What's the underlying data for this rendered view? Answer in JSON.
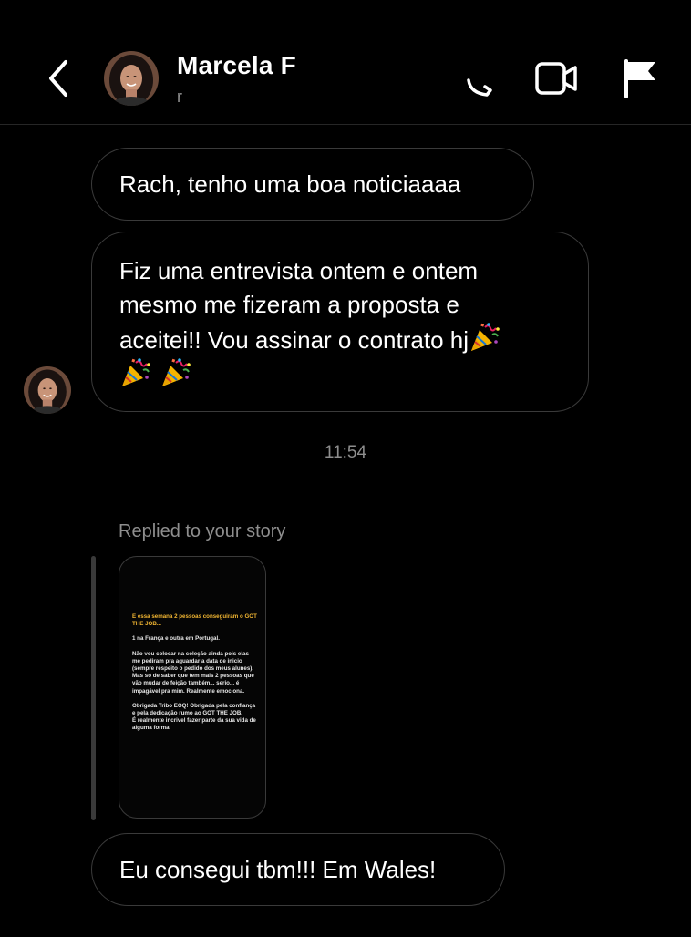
{
  "header": {
    "contact_name": "Marcela F",
    "contact_sub": "r"
  },
  "messages": [
    {
      "text": "Rach, tenho uma boa noticiaaaa"
    },
    {
      "lines": [
        "Fiz uma entrevista ontem e ontem",
        "mesmo me fizeram a proposta e",
        "aceitei!! Vou assinar o contrato hj"
      ]
    }
  ],
  "timestamp": "11:54",
  "reply": {
    "label": "Replied to your story",
    "story": {
      "heading": "E essa semana 2 pessoas conseguiram o GOT THE JOB...",
      "p1": "1 na França e outra em Portugal.",
      "p2": "Não vou colocar na coleção ainda pois elas me pediram pra aguardar a data de inicio (sempre respeito o pedido dos meus alunes).",
      "p3": "Mas só de saber que tem mais 2 pessoas que vão mudar de feição também... serio... é impagável pra mim. Realmente emociona.",
      "p4": "Obrigada Tribo EOQ! Obrigada pela confiança e pela dedicação rumo ao GOT THE JOB.",
      "p5": "É realmente incrivel fazer parte da sua vida de alguma forma."
    }
  },
  "last_message": {
    "text": "Eu consegui tbm!!! Em Wales!"
  },
  "icons": {
    "back": "chevron-left-icon",
    "call": "phone-icon",
    "video": "video-camera-icon",
    "flag": "flag-icon",
    "emoji": "party-popper-icon"
  },
  "colors": {
    "background": "#000000",
    "bubble_border": "#3a3a3a",
    "muted_text": "#8e8e8e",
    "story_heading": "#f2b632"
  }
}
